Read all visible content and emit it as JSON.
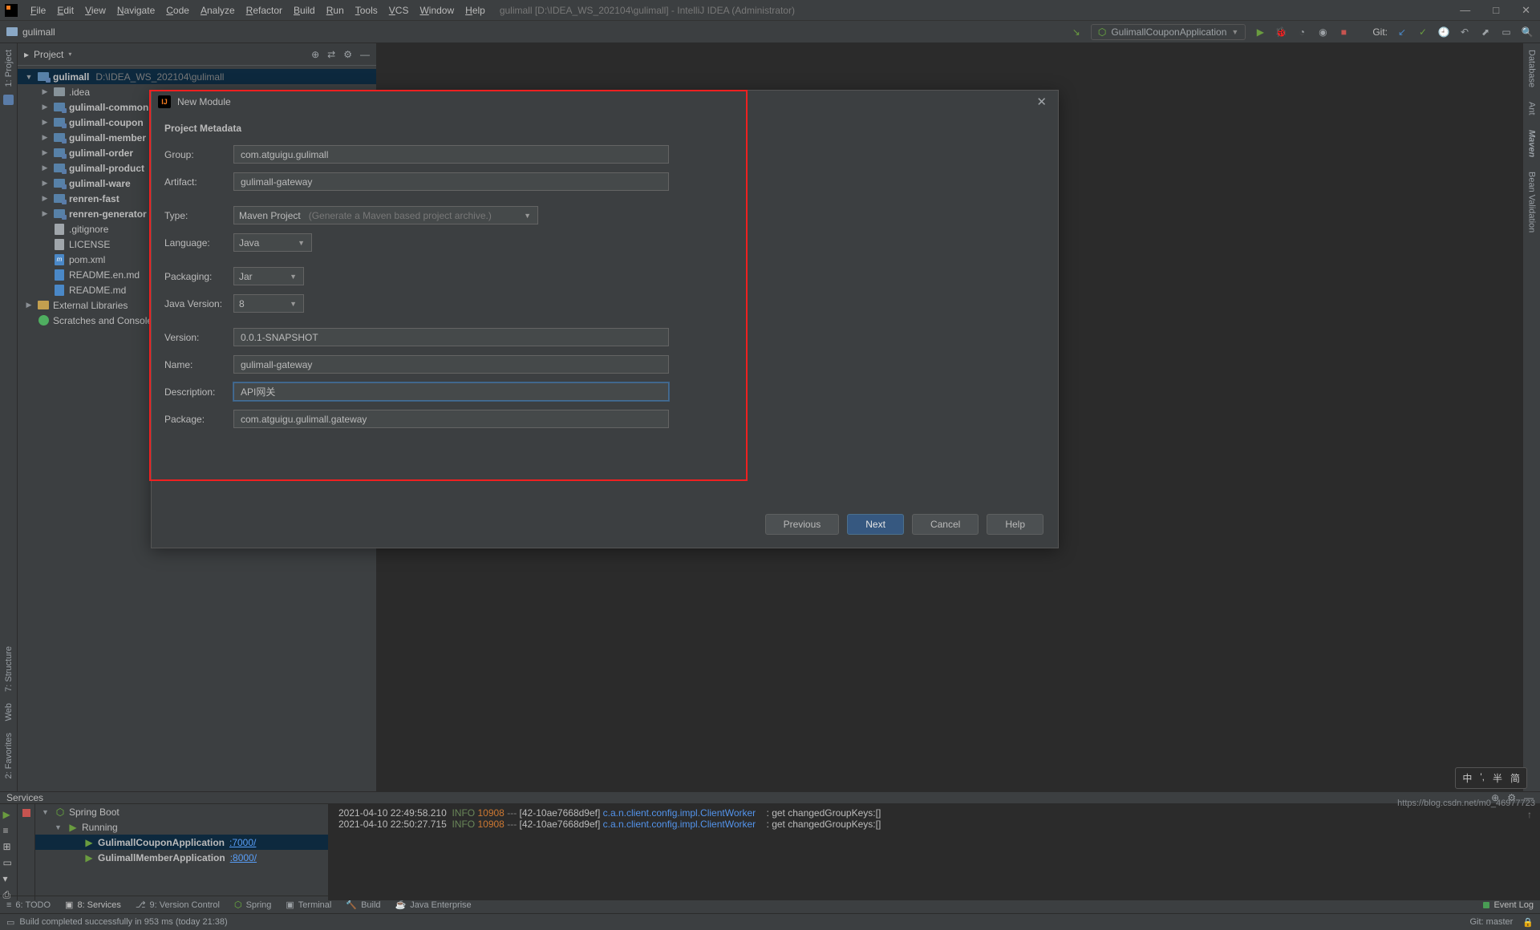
{
  "titlebar": {
    "menus": [
      "File",
      "Edit",
      "View",
      "Navigate",
      "Code",
      "Analyze",
      "Refactor",
      "Build",
      "Run",
      "Tools",
      "VCS",
      "Window",
      "Help"
    ],
    "title": "gulimall [D:\\IDEA_WS_202104\\gulimall] - IntelliJ IDEA (Administrator)"
  },
  "toolbar": {
    "crumb": "gulimall",
    "run_config": "GulimallCouponApplication",
    "git_label": "Git:"
  },
  "leftrail": {
    "project": "1: Project",
    "structure": "7: Structure",
    "web": "Web",
    "favorites": "2: Favorites"
  },
  "rightrail": {
    "database": "Database",
    "ant": "Ant",
    "maven": "Maven",
    "bean": "Bean Validation"
  },
  "project": {
    "header": "Project",
    "root": {
      "name": "gulimall",
      "path": "D:\\IDEA_WS_202104\\gulimall"
    },
    "children": [
      {
        "name": ".idea",
        "type": "folder"
      },
      {
        "name": "gulimall-common",
        "type": "module"
      },
      {
        "name": "gulimall-coupon",
        "type": "module"
      },
      {
        "name": "gulimall-member",
        "type": "module"
      },
      {
        "name": "gulimall-order",
        "type": "module"
      },
      {
        "name": "gulimall-product",
        "type": "module"
      },
      {
        "name": "gulimall-ware",
        "type": "module"
      },
      {
        "name": "renren-fast",
        "type": "module"
      },
      {
        "name": "renren-generator",
        "type": "module"
      },
      {
        "name": ".gitignore",
        "type": "file"
      },
      {
        "name": "LICENSE",
        "type": "file"
      },
      {
        "name": "pom.xml",
        "type": "xml"
      },
      {
        "name": "README.en.md",
        "type": "md"
      },
      {
        "name": "README.md",
        "type": "md"
      }
    ],
    "ext1": "External Libraries",
    "ext2": "Scratches and Consoles"
  },
  "dialog": {
    "title": "New Module",
    "section": "Project Metadata",
    "labels": {
      "group": "Group:",
      "artifact": "Artifact:",
      "type": "Type:",
      "language": "Language:",
      "packaging": "Packaging:",
      "java": "Java Version:",
      "version": "Version:",
      "name": "Name:",
      "description": "Description:",
      "package": "Package:"
    },
    "values": {
      "group": "com.atguigu.gulimall",
      "artifact": "gulimall-gateway",
      "type": "Maven Project",
      "type_hint": "(Generate a Maven based project archive.)",
      "language": "Java",
      "packaging": "Jar",
      "java": "8",
      "version": "0.0.1-SNAPSHOT",
      "name": "gulimall-gateway",
      "description": "API网关",
      "package": "com.atguigu.gulimall.gateway"
    },
    "buttons": {
      "prev": "Previous",
      "next": "Next",
      "cancel": "Cancel",
      "help": "Help"
    }
  },
  "services": {
    "title": "Services",
    "root": "Spring Boot",
    "running": "Running",
    "apps": [
      {
        "name": "GulimallCouponApplication",
        "port": ":7000/"
      },
      {
        "name": "GulimallMemberApplication",
        "port": ":8000/"
      }
    ],
    "log": [
      {
        "ts": "2021-04-10 22:49:58.210",
        "lvl": "INFO",
        "pid": "10908",
        "dash": "---",
        "thr": "[42-10ae7668d9ef]",
        "cls": "c.a.n.client.config.impl.ClientWorker",
        "msg": ": get changedGroupKeys:[]"
      },
      {
        "ts": "2021-04-10 22:50:27.715",
        "lvl": "INFO",
        "pid": "10908",
        "dash": "---",
        "thr": "[42-10ae7668d9ef]",
        "cls": "c.a.n.client.config.impl.ClientWorker",
        "msg": ": get changedGroupKeys:[]"
      }
    ]
  },
  "toolstrip": {
    "todo": "6: TODO",
    "services": "8: Services",
    "vcs": "9: Version Control",
    "spring": "Spring",
    "terminal": "Terminal",
    "build": "Build",
    "javaee": "Java Enterprise",
    "eventlog": "Event Log"
  },
  "statusbar": {
    "msg": "Build completed successfully in 953 ms (today 21:38)",
    "branch": "Git: master"
  },
  "ime": [
    "中",
    "',",
    "半",
    "简"
  ],
  "watermark": "https://blog.csdn.net/m0_46977723"
}
